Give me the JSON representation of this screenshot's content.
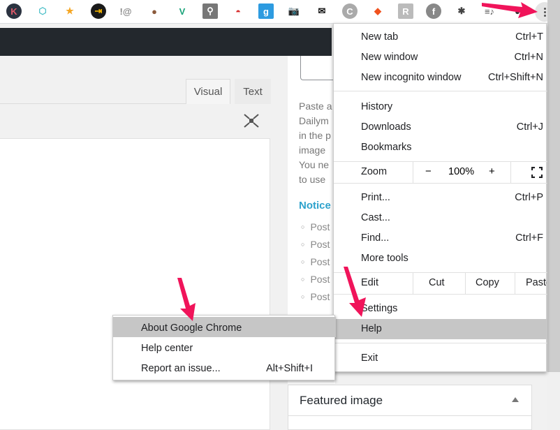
{
  "toolbar": {
    "extensions": [
      {
        "name": "k-extension-icon",
        "glyph": "K",
        "bg": "#2b3340",
        "fg": "#e05a6a",
        "shape": "circle"
      },
      {
        "name": "web-extension-icon",
        "glyph": "⬡",
        "bg": "#ffffff",
        "fg": "#4fc1c9",
        "shape": "none"
      },
      {
        "name": "star-extension-icon",
        "glyph": "★",
        "bg": "#ffffff",
        "fg": "#f5a623",
        "shape": "none"
      },
      {
        "name": "arrow-extension-icon",
        "glyph": "⇥",
        "bg": "#1a1a1a",
        "fg": "#f4b400",
        "shape": "circle"
      },
      {
        "name": "seo-extension-icon",
        "glyph": "!@",
        "bg": "#ffffff",
        "fg": "#888888",
        "shape": "none"
      },
      {
        "name": "cookie-extension-icon",
        "glyph": "●",
        "bg": "#ffffff",
        "fg": "#8b5a3c",
        "shape": "none"
      },
      {
        "name": "v-extension-icon",
        "glyph": "V",
        "bg": "#ffffff",
        "fg": "#1aa37a",
        "shape": "none"
      },
      {
        "name": "hubspot-extension-icon",
        "glyph": "⚲",
        "bg": "#777777",
        "fg": "#ffffff",
        "shape": "square"
      },
      {
        "name": "pokeball-extension-icon",
        "glyph": "◓",
        "bg": "#ffffff",
        "fg": "#d62b2b",
        "shape": "none"
      },
      {
        "name": "g-extension-icon",
        "glyph": "g",
        "bg": "#2d9be0",
        "fg": "#ffffff",
        "shape": "square"
      },
      {
        "name": "camera-extension-icon",
        "glyph": "📷",
        "bg": "#ffffff",
        "fg": "#888888",
        "shape": "none"
      },
      {
        "name": "message-extension-icon",
        "glyph": "✉",
        "bg": "#ffffff",
        "fg": "#111111",
        "shape": "none"
      },
      {
        "name": "c-extension-icon",
        "glyph": "C",
        "bg": "#aaaaaa",
        "fg": "#ffffff",
        "shape": "circle"
      },
      {
        "name": "fox-extension-icon",
        "glyph": "◆",
        "bg": "#ffffff",
        "fg": "#f0521e",
        "shape": "none"
      },
      {
        "name": "r-extension-icon",
        "glyph": "R",
        "bg": "#bbbbbb",
        "fg": "#ffffff",
        "shape": "square"
      },
      {
        "name": "facebook-extension-icon",
        "glyph": "f",
        "bg": "#888888",
        "fg": "#ffffff",
        "shape": "circle"
      },
      {
        "name": "puzzle-extensions-icon",
        "glyph": "✱",
        "bg": "#ffffff",
        "fg": "#444444",
        "shape": "none"
      },
      {
        "name": "media-control-icon",
        "glyph": "≡♪",
        "bg": "#ffffff",
        "fg": "#555555",
        "shape": "none"
      },
      {
        "name": "profile-avatar-icon",
        "glyph": "●",
        "bg": "#ffffff",
        "fg": "#333333",
        "shape": "none"
      }
    ]
  },
  "editor": {
    "tabs": [
      {
        "label": "Visual",
        "active": true
      },
      {
        "label": "Text",
        "active": false
      }
    ]
  },
  "sidebar": {
    "description_lines": [
      "Paste a",
      "Dailym",
      "in the p",
      "image",
      "You ne",
      "to use"
    ],
    "notice_title": "Notice",
    "post_items": [
      "Post",
      "Post",
      "Post",
      "Post",
      "Post"
    ],
    "featured_image_title": "Featured image"
  },
  "chrome_menu": {
    "new_tab": {
      "label": "New tab",
      "shortcut": "Ctrl+T"
    },
    "new_window": {
      "label": "New window",
      "shortcut": "Ctrl+N"
    },
    "new_incognito": {
      "label": "New incognito window",
      "shortcut": "Ctrl+Shift+N"
    },
    "history": {
      "label": "History"
    },
    "downloads": {
      "label": "Downloads",
      "shortcut": "Ctrl+J"
    },
    "bookmarks": {
      "label": "Bookmarks"
    },
    "zoom": {
      "label": "Zoom",
      "minus": "−",
      "value": "100%",
      "plus": "+"
    },
    "print": {
      "label": "Print...",
      "shortcut": "Ctrl+P"
    },
    "cast": {
      "label": "Cast..."
    },
    "find": {
      "label": "Find...",
      "shortcut": "Ctrl+F"
    },
    "more_tools": {
      "label": "More tools"
    },
    "edit": {
      "label": "Edit",
      "cut": "Cut",
      "copy": "Copy",
      "paste": "Paste"
    },
    "settings": {
      "label": "Settings"
    },
    "help": {
      "label": "Help"
    },
    "exit": {
      "label": "Exit"
    }
  },
  "help_menu": {
    "about": {
      "label": "About Google Chrome"
    },
    "help_center": {
      "label": "Help center"
    },
    "report_issue": {
      "label": "Report an issue...",
      "shortcut": "Alt+Shift+I"
    }
  },
  "colors": {
    "annotation_arrow": "#f0145a",
    "highlight": "#c6c6c6",
    "notice_link": "#2ea2cc",
    "admin_bar": "#23282d"
  }
}
